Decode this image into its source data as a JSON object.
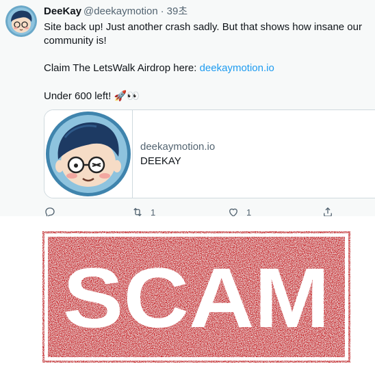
{
  "tweet": {
    "display_name": "DeeKay",
    "handle": "@deekaymotion",
    "separator": "·",
    "time": "39초",
    "text_line1": "Site back up! Just another crash sadly. But that shows how insane our community is!",
    "text_line2_prefix": "Claim The LetsWalk Airdrop here: ",
    "text_line2_link": "deekaymotion.io",
    "text_line3": "Under 600 left! ",
    "text_line3_emoji": "🚀👀"
  },
  "card": {
    "domain": "deekaymotion.io",
    "title": "DEEKAY"
  },
  "actions": {
    "reply_count": "",
    "retweet_count": "1",
    "like_count": "1"
  },
  "icons": {
    "reply": "reply-icon",
    "retweet": "retweet-icon",
    "like": "heart-icon",
    "share": "share-icon"
  },
  "banner": {
    "text": "SCAM",
    "color": "#c81e21"
  }
}
